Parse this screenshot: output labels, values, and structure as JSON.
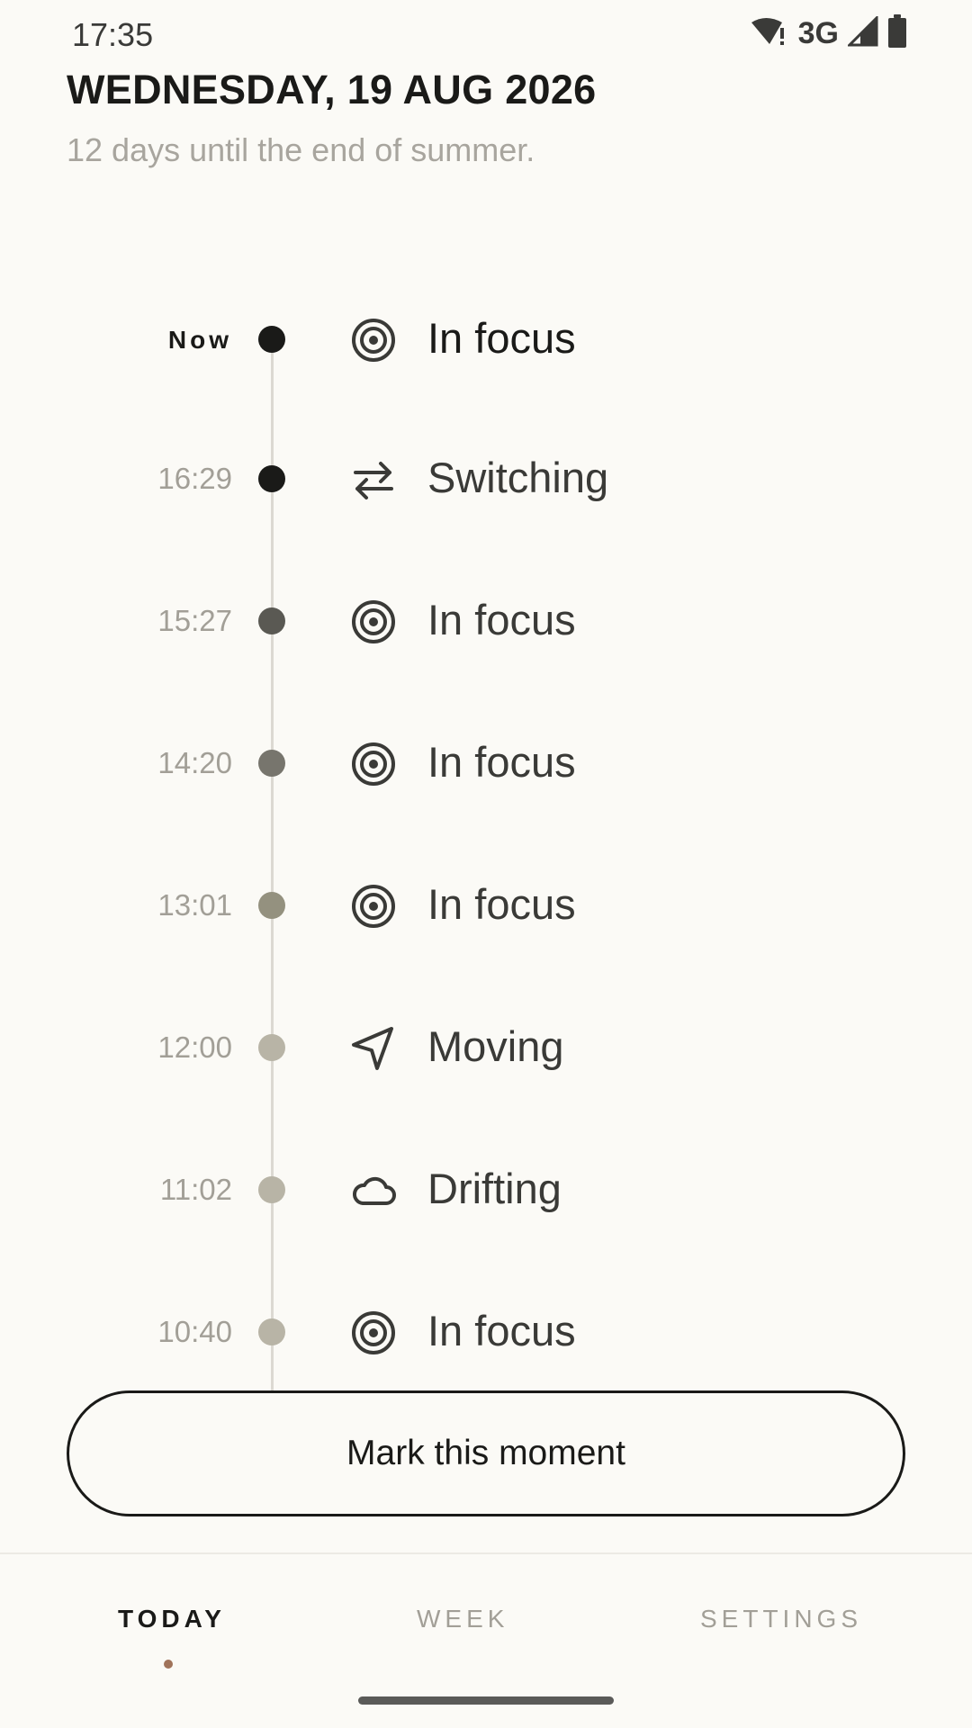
{
  "status_bar": {
    "time": "17:35",
    "network": "3G"
  },
  "header": {
    "date": "WEDNESDAY, 19 AUG 2026",
    "subtitle": "12 days until the end of summer."
  },
  "timeline": {
    "entries": [
      {
        "time": "Now",
        "label": "In focus",
        "icon": "target-icon",
        "dot_color": "#1A1A18"
      },
      {
        "time": "16:29",
        "label": "Switching",
        "icon": "switch-arrows-icon",
        "dot_color": "#1A1A18"
      },
      {
        "time": "15:27",
        "label": "In focus",
        "icon": "target-icon",
        "dot_color": "#5A5953"
      },
      {
        "time": "14:20",
        "label": "In focus",
        "icon": "target-icon",
        "dot_color": "#77756D"
      },
      {
        "time": "13:01",
        "label": "In focus",
        "icon": "target-icon",
        "dot_color": "#94917F"
      },
      {
        "time": "12:00",
        "label": "Moving",
        "icon": "navigation-arrow-icon",
        "dot_color": "#B8B4A6"
      },
      {
        "time": "11:02",
        "label": "Drifting",
        "icon": "cloud-icon",
        "dot_color": "#B8B4A6"
      },
      {
        "time": "10:40",
        "label": "In focus",
        "icon": "target-icon",
        "dot_color": "#B8B4A6"
      }
    ]
  },
  "actions": {
    "mark_label": "Mark this moment"
  },
  "bottom_nav": {
    "tabs": [
      {
        "label": "TODAY",
        "active": true
      },
      {
        "label": "WEEK",
        "active": false
      },
      {
        "label": "SETTINGS",
        "active": false
      }
    ],
    "indicator_color": "#A0735A"
  }
}
